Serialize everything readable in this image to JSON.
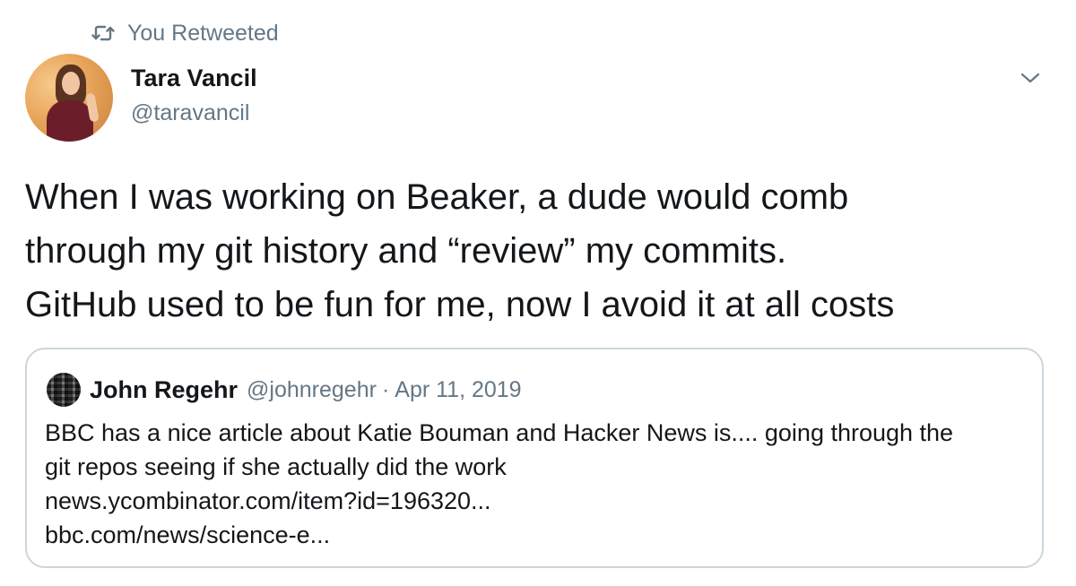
{
  "retweet": {
    "icon": "retweet-icon",
    "label": "You Retweeted"
  },
  "tweet": {
    "author_name": "Tara Vancil",
    "author_handle": "@taravancil",
    "menu_icon": "chevron-down-icon",
    "text_lines": [
      "When I was working on Beaker, a dude would comb",
      "through my git history and “review” my commits.",
      "GitHub used to be fun for me, now I avoid it at all costs"
    ]
  },
  "quoted_tweet": {
    "author_name": "John Regehr",
    "author_handle": "@johnregehr",
    "separator": "·",
    "date": "Apr 11, 2019",
    "text_lines": [
      "BBC has a nice article about Katie Bouman and Hacker News is.... going through the",
      "git repos seeing if she actually did the work",
      "news.ycombinator.com/item?id=196320...",
      "bbc.com/news/science-e..."
    ]
  },
  "colors": {
    "text_primary": "#14171a",
    "text_secondary": "#657786",
    "border": "#ccd6dd",
    "background": "#ffffff"
  }
}
